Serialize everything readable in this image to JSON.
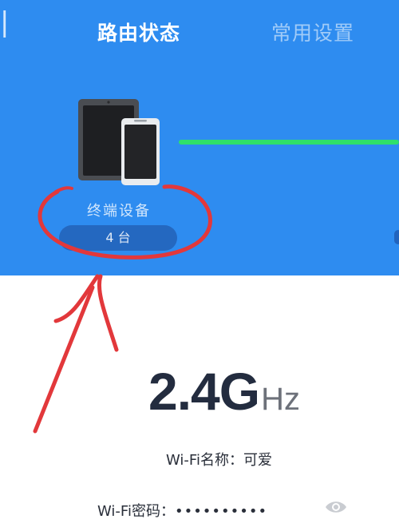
{
  "tabs": [
    {
      "label": "路由状态",
      "active": true
    },
    {
      "label": "常用设置",
      "active": false
    }
  ],
  "terminal": {
    "label": "终端设备",
    "count": "4 台",
    "icon": "tablet-phone-icon"
  },
  "connection": {
    "status_color": "#2fe06b"
  },
  "wifi": {
    "frequency_value": "2.4G",
    "frequency_unit": "Hz",
    "ssid_label": "Wi-Fi名称：",
    "ssid_value": "可爱",
    "password_label": "Wi-Fi密码：",
    "password_masked": "••••••••••",
    "password_toggle_icon": "eye-icon"
  },
  "annotation": {
    "type": "hand-drawn red circle and arrow",
    "color": "#e2383b"
  },
  "colors": {
    "hero_background": "#2e8cf0",
    "page_background": "#ffffff",
    "accent_text": "#232c3f"
  }
}
